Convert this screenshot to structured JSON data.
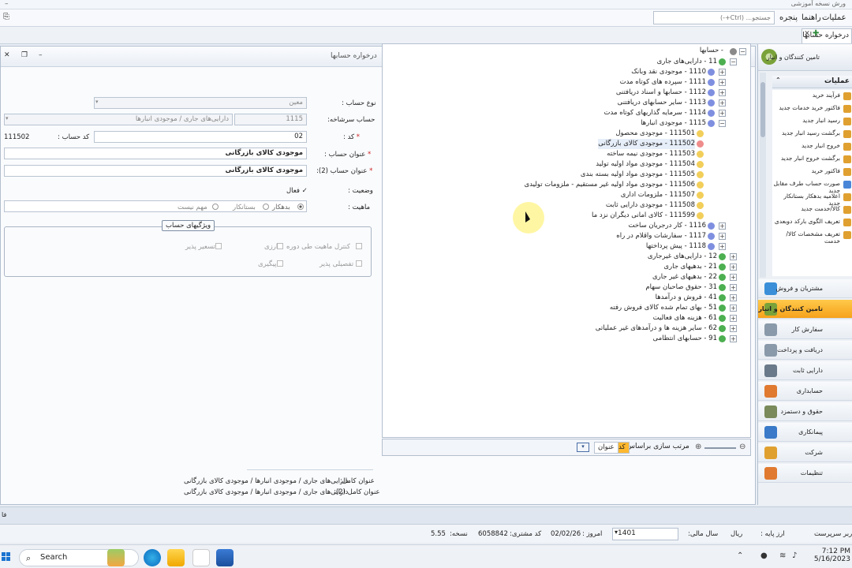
{
  "app": {
    "title": "ورش نسخه آموزشی",
    "menu": [
      "عملیات",
      "راهنما",
      "پنجره"
    ],
    "search_placeholder": "جستجو... (Ctrl+-)",
    "tab_label": "درخواره حسابها"
  },
  "window": {
    "title": "درخواره حسابها"
  },
  "form": {
    "type_label": "نوع حساب :",
    "type_value": "معین",
    "parent_label": "حساب سرشاخه:",
    "parent_code": "1115",
    "parent_name": "دارایی‌های جاری / موجودی انبارها",
    "code_label": "کد :",
    "code_value": "02",
    "account_code_label": "کد حساب :",
    "account_code_value": "111502",
    "title_label": "عنوان حساب :",
    "title_value": "موجودی کالای بازرگانی",
    "title2_label": "عنوان حساب (2):",
    "title2_value": "موجودی کالای بازرگانی",
    "status_label": "وضعیت :",
    "status_value": "فعال",
    "nature_label": "ماهیت :",
    "nature_options": [
      "بدهکار",
      "بستانکار",
      "مهم نیست"
    ],
    "group_title": "ویژگیهای حساب",
    "checks": [
      "کنترل ماهیت طی دوره",
      "ارزی",
      "تسعیر پذیر",
      "تفصیلی پذیر",
      "پیگیری"
    ],
    "full_title_label": "عنوان کامل:",
    "full_title_value": "دارایی‌های جاری / موجودی انبارها / موجودی کالای بازرگانی",
    "full_title2_label": "عنوان کامل (2):",
    "full_title2_value": "دارایی‌های جاری / موجودی انبارها / موجودی کالای بازرگانی"
  },
  "tree": {
    "root": "حسابها",
    "nodes": [
      {
        "code": "11",
        "name": "دارایی‌های جاری",
        "level": 1,
        "color": "#4caf50"
      },
      {
        "code": "1110",
        "name": "موجودی نقد وبانک",
        "level": 2,
        "color": "#7f8fe0"
      },
      {
        "code": "1111",
        "name": "سپرده های کوتاه مدت",
        "level": 2,
        "color": "#7f8fe0"
      },
      {
        "code": "1112",
        "name": "حسابها و اسناد دریافتنی",
        "level": 2,
        "color": "#7f8fe0"
      },
      {
        "code": "1113",
        "name": "سایر حسابهای دریافتنی",
        "level": 2,
        "color": "#7f8fe0"
      },
      {
        "code": "1114",
        "name": "سرمایه گذاریهای کوتاه مدت",
        "level": 2,
        "color": "#7f8fe0"
      },
      {
        "code": "1115",
        "name": "موجودی انبارها",
        "level": 2,
        "color": "#7f8fe0"
      },
      {
        "code": "111501",
        "name": "موجودی محصول",
        "level": 3,
        "color": "#f2cf5b"
      },
      {
        "code": "111502",
        "name": "موجودی کالای بازرگانی",
        "level": 3,
        "color": "#ef8c8c"
      },
      {
        "code": "111503",
        "name": "موجودی نیمه ساخته",
        "level": 3,
        "color": "#f2cf5b"
      },
      {
        "code": "111504",
        "name": "موجودی مواد اولیه تولید",
        "level": 3,
        "color": "#f2cf5b"
      },
      {
        "code": "111505",
        "name": "موجودی مواد اولیه بسته بندی",
        "level": 3,
        "color": "#f2cf5b"
      },
      {
        "code": "111506",
        "name": "موجودی مواد اولیه غیر مستقیم - ملزومات تولیدی",
        "level": 3,
        "color": "#f2cf5b"
      },
      {
        "code": "111507",
        "name": "ملزومات اداری",
        "level": 3,
        "color": "#f2cf5b"
      },
      {
        "code": "111508",
        "name": "موجودی دارایی ثابت",
        "level": 3,
        "color": "#f2cf5b"
      },
      {
        "code": "111599",
        "name": "کالای امانی دیگران نزد ما",
        "level": 3,
        "color": "#f2cf5b"
      },
      {
        "code": "1116",
        "name": "کار درجریان ساخت",
        "level": 2,
        "color": "#7f8fe0"
      },
      {
        "code": "1117",
        "name": "سفارشات واقلام در راه",
        "level": 2,
        "color": "#7f8fe0"
      },
      {
        "code": "1118",
        "name": "پیش پرداختها",
        "level": 2,
        "color": "#7f8fe0"
      },
      {
        "code": "12",
        "name": "دارایی‌های غیرجاری",
        "level": 1,
        "color": "#4caf50"
      },
      {
        "code": "21",
        "name": "بدهیهای جاری",
        "level": 1,
        "color": "#4caf50"
      },
      {
        "code": "22",
        "name": "بدهیهای غیر جاری",
        "level": 1,
        "color": "#4caf50"
      },
      {
        "code": "31",
        "name": "حقوق صاحبان سهام",
        "level": 1,
        "color": "#4caf50"
      },
      {
        "code": "41",
        "name": "فروش و درآمدها",
        "level": 1,
        "color": "#4caf50"
      },
      {
        "code": "51",
        "name": "بهای تمام شده کالای فروش رفته",
        "level": 1,
        "color": "#4caf50"
      },
      {
        "code": "61",
        "name": "هزینه های فعالیت",
        "level": 1,
        "color": "#4caf50"
      },
      {
        "code": "62",
        "name": "سایر هزینه ها و درآمدهای غیر عملیاتی",
        "level": 1,
        "color": "#4caf50"
      },
      {
        "code": "91",
        "name": "حسابهای انتظامی",
        "level": 1,
        "color": "#4caf50"
      }
    ],
    "footer_sort_label": "مرتب سازی براساس:",
    "sort_code": "کد",
    "sort_title": "عنوان"
  },
  "nav": {
    "header": "تامین کنندگان و انبار",
    "section": "عملیات",
    "items": [
      {
        "label": "فرآیند خرید",
        "color": "#e0a030"
      },
      {
        "label": "فاکتور خرید خدمات جدید",
        "color": "#e0a030"
      },
      {
        "label": "رسید انبار جدید",
        "color": "#e0a030"
      },
      {
        "label": "برگشت رسید انبار جدید",
        "color": "#e0a030"
      },
      {
        "label": "خروج انبار جدید",
        "color": "#e0a030"
      },
      {
        "label": "برگشت خروج انبار جدید",
        "color": "#e0a030"
      },
      {
        "label": "فاکتور خرید",
        "color": "#e0a030"
      },
      {
        "label": "صورت حساب طرف مقابل جدید",
        "color": "#4a86d8"
      },
      {
        "label": "اعلامیه بدهکار بستانکار جدید",
        "color": "#e0a030"
      },
      {
        "label": "کالا/خدمت جدید",
        "color": "#e0a030"
      },
      {
        "label": "تعریف الگوی بارکد دوبعدی",
        "color": "#e0a030"
      },
      {
        "label": "تعریف مشخصات کالا/خدمت",
        "color": "#e0a030"
      }
    ],
    "modules": [
      {
        "label": "مشتریان و فروش",
        "color": "#3a8fd8",
        "active": false
      },
      {
        "label": "تامین کنندگان و انبار",
        "color": "#7aa23a",
        "active": true
      },
      {
        "label": "سفارش کار",
        "color": "#8a9aaa",
        "active": false
      },
      {
        "label": "دریافت و پرداخت",
        "color": "#8a9aaa",
        "active": false
      },
      {
        "label": "دارایی ثابت",
        "color": "#6a7a8a",
        "active": false
      },
      {
        "label": "حسابداری",
        "color": "#e07a30",
        "active": false
      },
      {
        "label": "حقوق و دستمزد",
        "color": "#7a8a5a",
        "active": false
      },
      {
        "label": "پیمانکاری",
        "color": "#3a7ac8",
        "active": false
      },
      {
        "label": "شرکت",
        "color": "#e0a030",
        "active": false
      },
      {
        "label": "تنظیمات",
        "color": "#e07a30",
        "active": false
      }
    ]
  },
  "status": {
    "user_label": "کاربر سرپرست",
    "base_currency": "ارز پایه :",
    "currency_value": "ریال",
    "fiscal_label": "سال مالی:",
    "fiscal_value": "1401",
    "today_label": "امروز :",
    "today_value": "02/02/26",
    "customer_label": "کد مشتری:",
    "customer_value": "6058842",
    "version_label": "نسخه:",
    "version_value": "5.55"
  },
  "taskbar": {
    "search": "Search",
    "time": "7:12 PM",
    "date": "5/16/2023"
  }
}
